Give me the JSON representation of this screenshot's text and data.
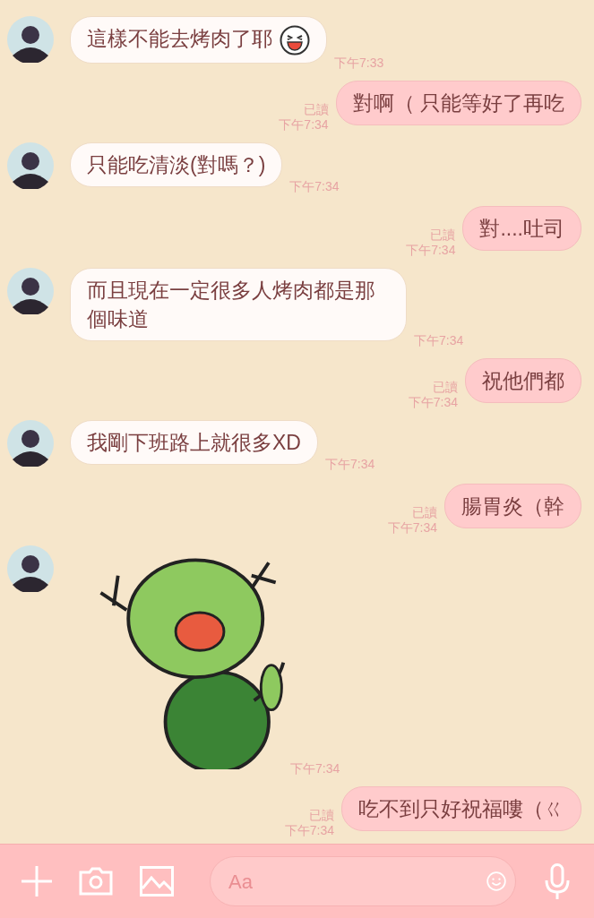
{
  "messages": [
    {
      "kind": "text",
      "outgoing": false,
      "text": "這樣不能去烤肉了耶",
      "emoji": true,
      "time": "下午7:33"
    },
    {
      "kind": "text",
      "outgoing": true,
      "text": "對啊（ 只能等好了再吃",
      "read": "已讀",
      "time": "下午7:34"
    },
    {
      "kind": "text",
      "outgoing": false,
      "text": "只能吃清淡(對嗎？)",
      "time": "下午7:34"
    },
    {
      "kind": "text",
      "outgoing": true,
      "text": "對....吐司",
      "read": "已讀",
      "time": "下午7:34"
    },
    {
      "kind": "text",
      "outgoing": false,
      "text": "而且現在一定很多人烤肉都是那個味道",
      "time": "下午7:34"
    },
    {
      "kind": "text",
      "outgoing": true,
      "text": "祝他們都",
      "read": "已讀",
      "time": "下午7:34"
    },
    {
      "kind": "text",
      "outgoing": false,
      "text": "我剛下班路上就很多XD",
      "time": "下午7:34"
    },
    {
      "kind": "text",
      "outgoing": true,
      "text": "腸胃炎（幹",
      "read": "已讀",
      "time": "下午7:34"
    },
    {
      "kind": "sticker",
      "outgoing": false,
      "time": "下午7:34"
    },
    {
      "kind": "text",
      "outgoing": true,
      "text": "吃不到只好祝福嘍（ㄍ",
      "read": "已讀",
      "time": "下午7:34"
    }
  ],
  "input": {
    "placeholder": "Aa"
  }
}
